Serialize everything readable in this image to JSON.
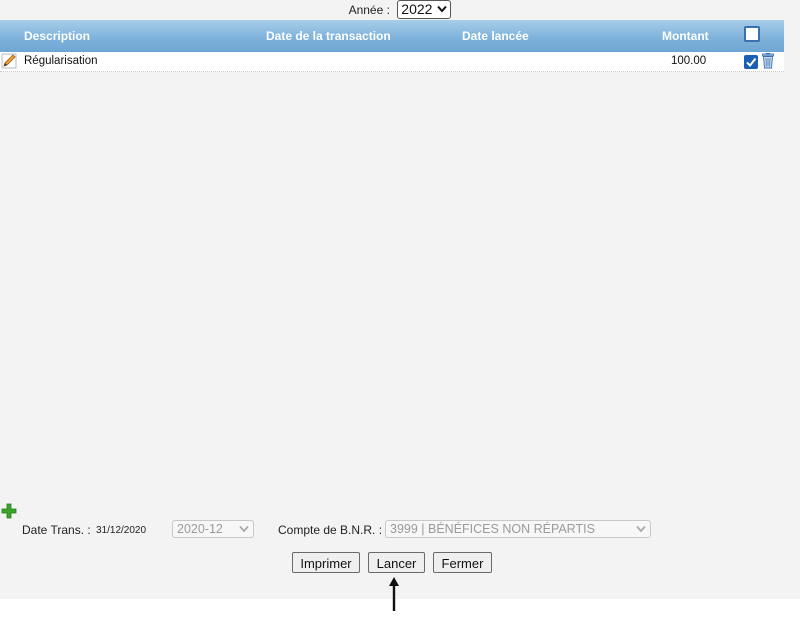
{
  "filter": {
    "year_label": "Année :",
    "year_value": "2022"
  },
  "table": {
    "columns": [
      "Description",
      "Date de la transaction",
      "Date lancée",
      "Montant"
    ],
    "rows": [
      {
        "description": "Régularisation",
        "transaction_date": "",
        "launched_date": "",
        "amount": "100.00",
        "checked": true
      }
    ]
  },
  "footer": {
    "date_trans_label": "Date Trans. :",
    "date_trans_value": "31/12/2020",
    "period_value": "2020-12",
    "account_label": "Compte de B.N.R. :",
    "account_value": "3999 | BÉNÉFICES NON RÉPARTIS"
  },
  "buttons": {
    "print": "Imprimer",
    "launch": "Lancer",
    "close": "Fermer"
  },
  "colors": {
    "header_top": "#a8cde8",
    "header_bottom": "#6ea6d3",
    "check_blue": "#1a5fb4",
    "add_green": "#3aa52c"
  },
  "icons": [
    "chevron-down-icon",
    "edit-pencil-icon",
    "trash-icon",
    "add-plus-icon",
    "arrow-up-icon"
  ]
}
